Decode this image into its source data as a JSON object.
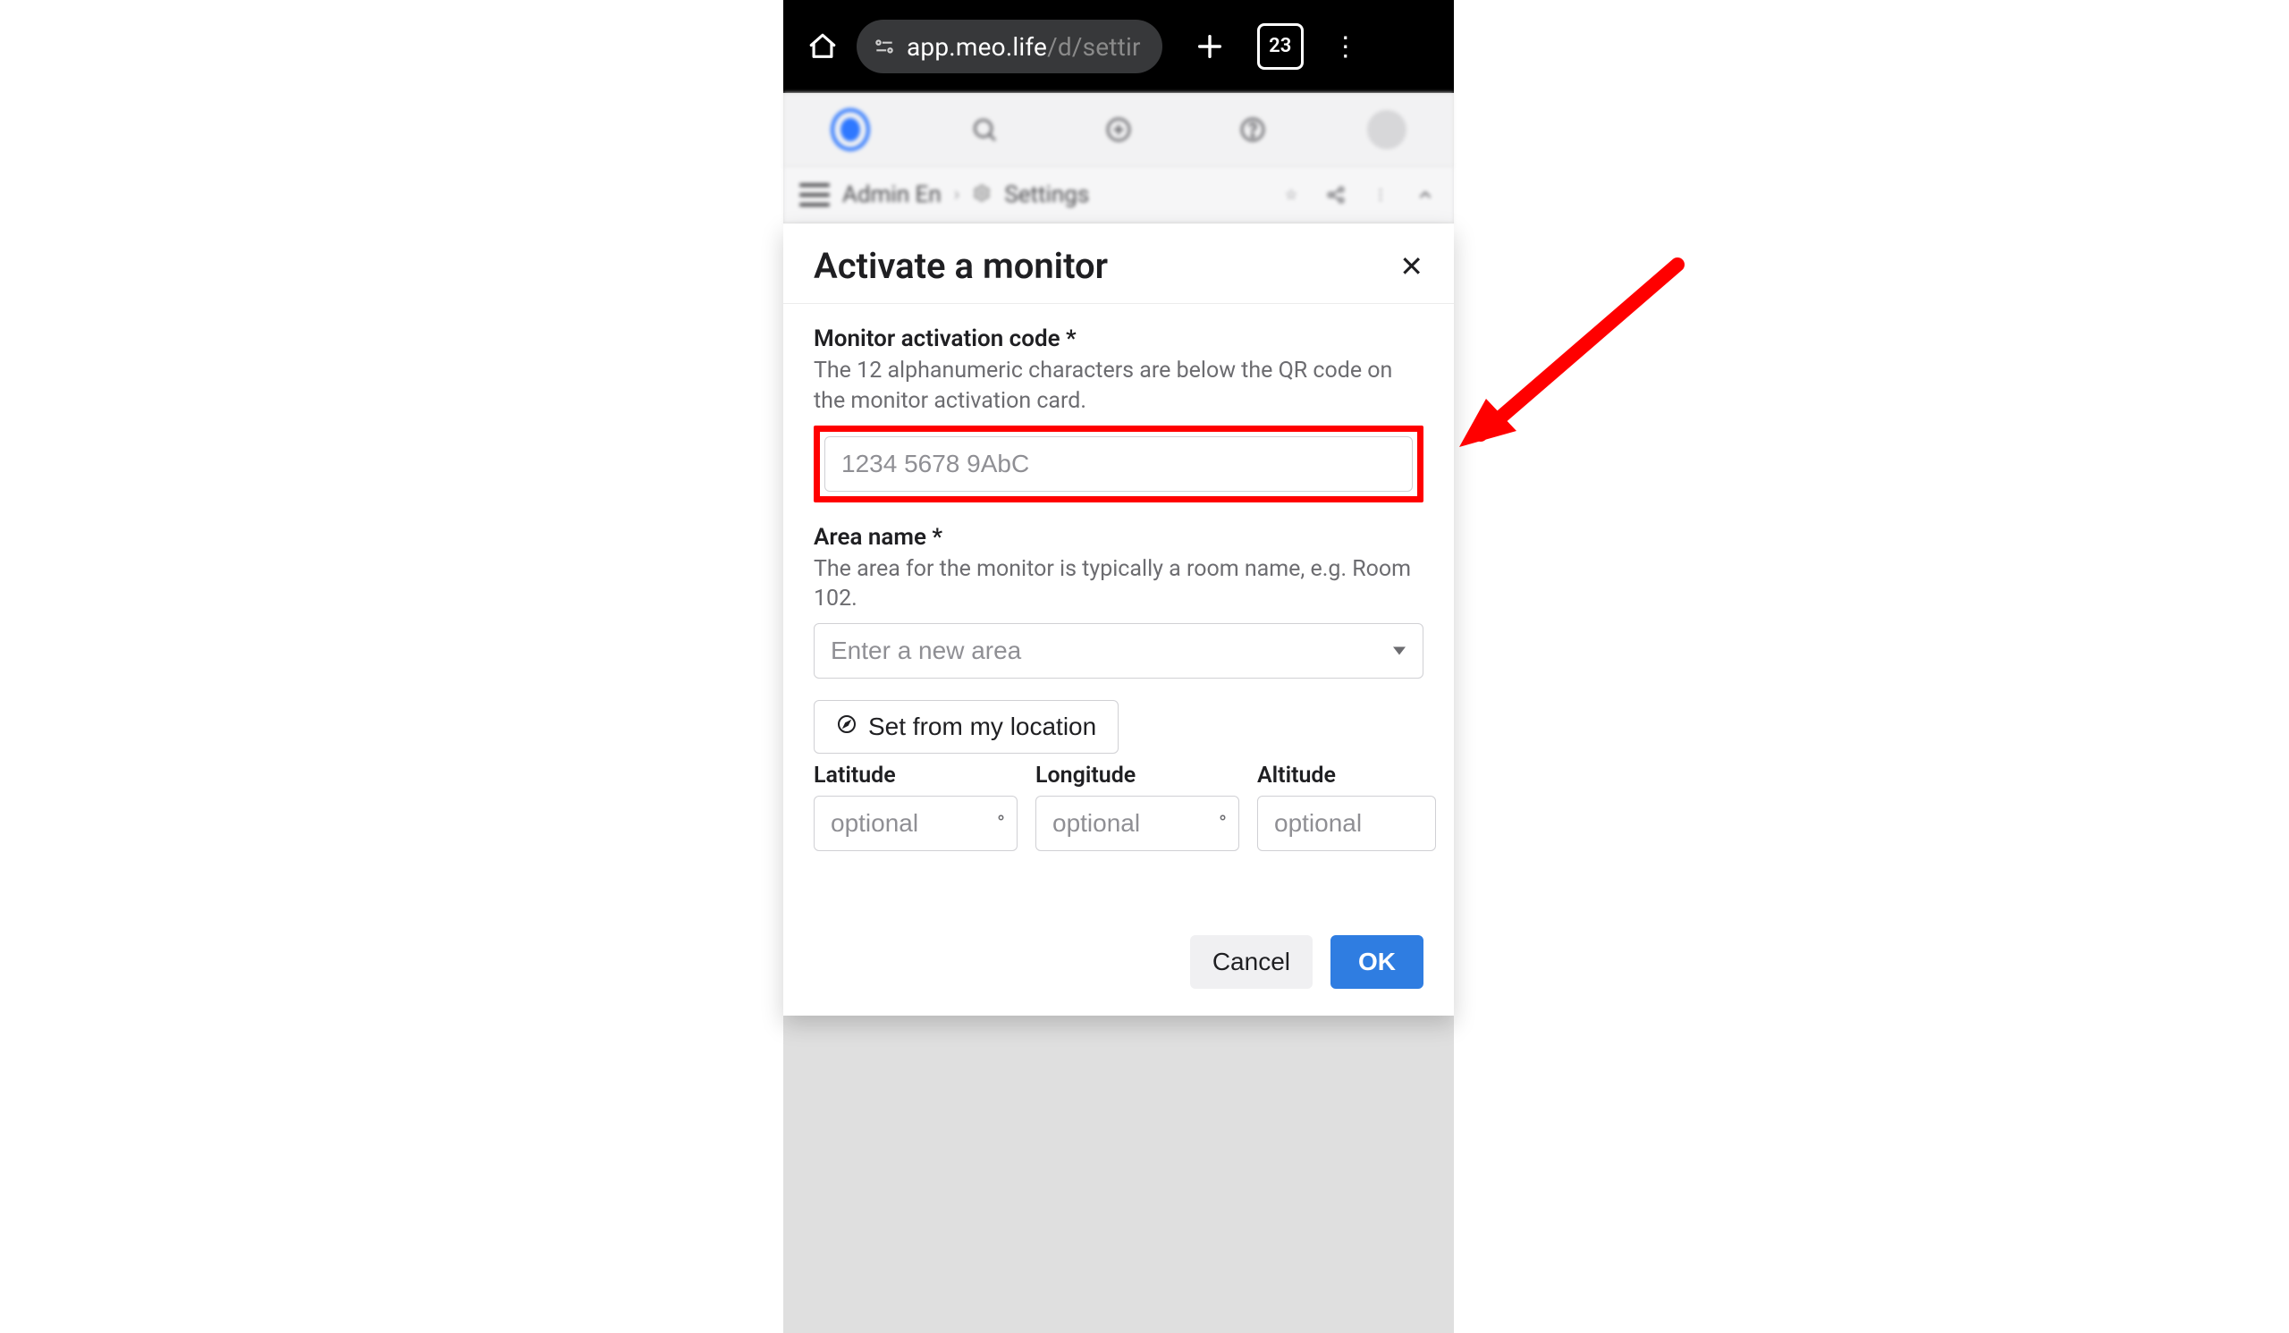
{
  "browser": {
    "url_host": "app.meo.life",
    "url_path": "/d/settir",
    "tab_count": "23"
  },
  "breadcrumb": {
    "item0": "Admin En",
    "item1": "Settings"
  },
  "modal": {
    "title": "Activate a monitor",
    "activation": {
      "label": "Monitor activation code *",
      "help": "The 12 alphanumeric characters are below the QR code on the monitor activation card.",
      "placeholder": "1234 5678 9AbC"
    },
    "area": {
      "label": "Area name *",
      "help": "The area for the monitor is typically a room name, e.g. Room 102.",
      "placeholder": "Enter a new area"
    },
    "location_button": "Set from my location",
    "coords": {
      "lat_label": "Latitude",
      "lon_label": "Longitude",
      "alt_label": "Altitude",
      "placeholder": "optional",
      "deg": "°"
    },
    "buttons": {
      "cancel": "Cancel",
      "ok": "OK"
    }
  }
}
